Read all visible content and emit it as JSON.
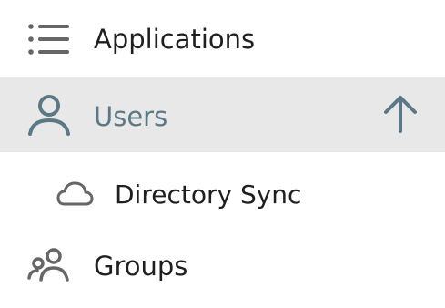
{
  "sidebar": {
    "items": [
      {
        "label": "Applications",
        "icon": "list-icon",
        "selected": false
      },
      {
        "label": "Users",
        "icon": "user-icon",
        "selected": true,
        "expanded": true,
        "toggle_icon": "arrow-up-icon"
      },
      {
        "label": "Directory Sync",
        "icon": "cloud-icon",
        "selected": false,
        "child_of": "Users"
      },
      {
        "label": "Groups",
        "icon": "groups-icon",
        "selected": false
      }
    ]
  },
  "colors": {
    "selected_background": "#e8e8e8",
    "selected_text": "#5c7886",
    "text": "#1f1f1f",
    "icon": "#666666",
    "selected_icon": "#5c7886"
  }
}
